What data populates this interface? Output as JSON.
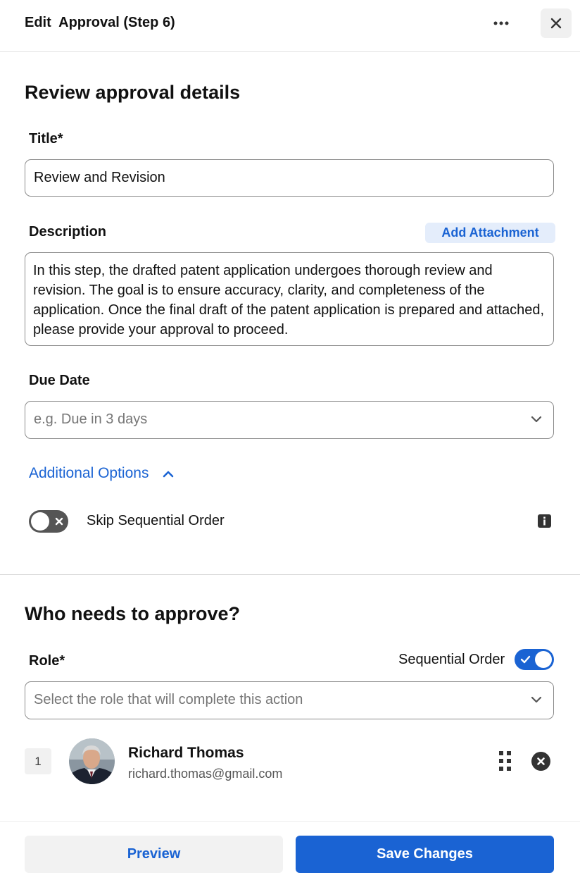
{
  "header": {
    "title": "Edit  Approval (Step 6)",
    "more_icon": "ellipsis-icon",
    "close_icon": "close-icon"
  },
  "details": {
    "heading": "Review approval details",
    "title_label": "Title*",
    "title_value": "Review and Revision",
    "description_label": "Description",
    "add_attachment_label": "Add Attachment",
    "description_value": "In this step, the drafted patent application undergoes thorough review and revision. The goal is to ensure accuracy, clarity, and completeness of the application. Once the final draft of the patent application is prepared and attached, please provide your approval to proceed.",
    "due_date_label": "Due Date",
    "due_date_placeholder": "e.g. Due in 3 days",
    "additional_options_label": "Additional Options",
    "skip_sequential_label": "Skip Sequential Order",
    "skip_sequential_enabled": false
  },
  "approvers": {
    "heading": "Who needs to approve?",
    "role_label": "Role*",
    "sequential_order_label": "Sequential Order",
    "sequential_order_enabled": true,
    "role_placeholder": "Select the role that will complete this action",
    "list": [
      {
        "order": "1",
        "name": "Richard Thomas",
        "email": "richard.thomas@gmail.com"
      }
    ]
  },
  "footer": {
    "preview_label": "Preview",
    "save_label": "Save Changes"
  },
  "colors": {
    "accent": "#1a63d3",
    "accent_light": "#e4edfb",
    "border": "#8c8c8c",
    "toggle_off": "#555555"
  }
}
